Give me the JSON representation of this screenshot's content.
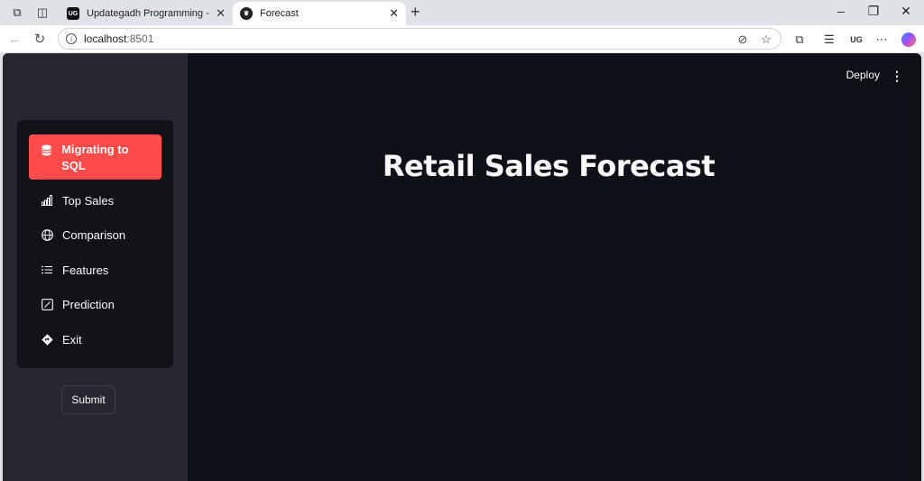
{
  "browser": {
    "tabs": [
      {
        "title": "Updategadh Programming - Upd",
        "favicon": "UG"
      },
      {
        "title": "Forecast",
        "favicon": "streamlit-crown"
      }
    ],
    "address": {
      "host": "localhost",
      "port": ":8501"
    }
  },
  "sidebar": {
    "menu": [
      {
        "label": "Migrating to SQL",
        "icon": "database-icon"
      },
      {
        "label": "Top Sales",
        "icon": "bar-chart-icon"
      },
      {
        "label": "Comparison",
        "icon": "globe-icon"
      },
      {
        "label": "Features",
        "icon": "list-icon"
      },
      {
        "label": "Prediction",
        "icon": "graph-box-icon"
      },
      {
        "label": "Exit",
        "icon": "sign-icon"
      }
    ],
    "submit_label": "Submit"
  },
  "header": {
    "deploy_label": "Deploy"
  },
  "main": {
    "title": "Retail Sales Forecast"
  },
  "colors": {
    "accent": "#ff4b4b",
    "background": "#0e1117",
    "sidebar": "#262730"
  }
}
